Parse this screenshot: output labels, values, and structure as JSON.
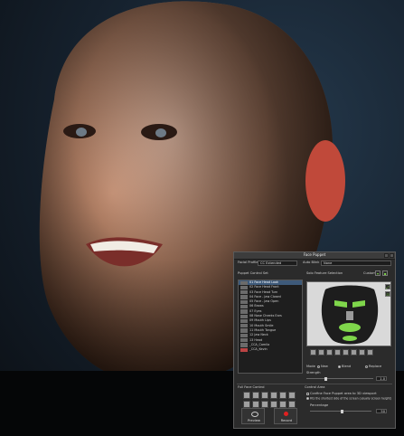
{
  "panel": {
    "title": "Face Puppet",
    "face_profile_label": "Facial Profile",
    "face_profile_value": "CC Extended",
    "auto_blink_label": "Auto Blink",
    "auto_blink_value": "None",
    "puppet_control_set_label": "Puppet Control Set",
    "solo_feature_label": "Solo Feature Selection",
    "custom_label": "Custom",
    "list_items": [
      "01 Face Head Look",
      "02 Face Head Front",
      "03 Face Head Turn",
      "04 Face - Jaw Closed",
      "05 Face - Jaw Open",
      "06 Brows",
      "07 Eyes",
      "08 Nose Cheeks Ears",
      "09 Mouth Lips",
      "10 Mouth Smile",
      "11 Mouth Tongue",
      "12 Jaw Neck",
      "13 Head",
      "_CCA_Camila",
      "_CCA_Kevin"
    ],
    "mode_label": "Mode",
    "mode_options": [
      "New",
      "Blend",
      "Replace"
    ],
    "strength_label": "Strength",
    "strength_value": "1.0",
    "full_face_label": "Full Face Control",
    "control_area_label": "Control Area",
    "confine_label": "Confine Face Puppet area to 3D viewport",
    "fit_label": "Fits the shortest side of the screen (usually screen height)",
    "percentage_label": "Percentage",
    "percentage_value": "50",
    "preview_label": "Preview",
    "record_label": "Record"
  },
  "colors": {
    "accent_green": "#7fd64b",
    "record_red": "#e02020",
    "selection_blue": "#3e5a7a"
  }
}
